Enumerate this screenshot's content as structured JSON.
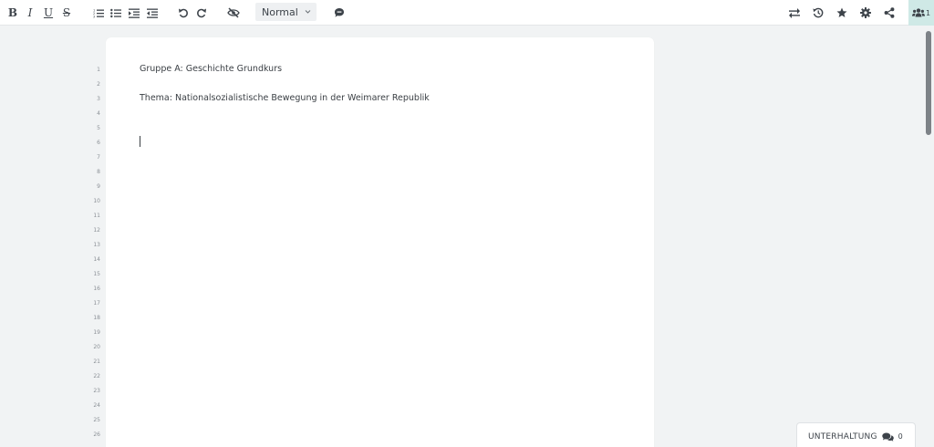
{
  "toolbar": {
    "bold_label": "B",
    "italic_label": "I",
    "underline_label": "U",
    "strike_label": "S",
    "style_select": {
      "selected": "Normal"
    },
    "users_count": "1",
    "icons": [
      "bold-icon",
      "italic-icon",
      "underline-icon",
      "strikethrough-icon",
      "ordered-list-icon",
      "bullet-list-icon",
      "indent-icon",
      "outdent-icon",
      "undo-icon",
      "redo-icon",
      "hide-eye-icon",
      "chevron-down-icon",
      "comment-icon",
      "swap-icon",
      "history-icon",
      "star-icon",
      "gear-icon",
      "share-icon",
      "users-icon"
    ]
  },
  "document": {
    "line_numbers": [
      "1",
      "2",
      "3",
      "4",
      "5",
      "6",
      "7",
      "8",
      "9",
      "10",
      "11",
      "12",
      "13",
      "14",
      "15",
      "16",
      "17",
      "18",
      "19",
      "20",
      "21",
      "22",
      "23",
      "24",
      "25",
      "26"
    ],
    "lines": [
      "Gruppe A: Geschichte Grundkurs",
      "Thema: Nationalsozialistische Bewegung in der Weimarer Republik"
    ]
  },
  "conversation": {
    "label": "UNTERHALTUNG",
    "count": "0"
  },
  "colors": {
    "background": "#f1f3f4",
    "page": "#ffffff",
    "text": "#3a3f44",
    "users_highlight": "#cfe9e6",
    "scroll_thumb": "#7d8287"
  }
}
